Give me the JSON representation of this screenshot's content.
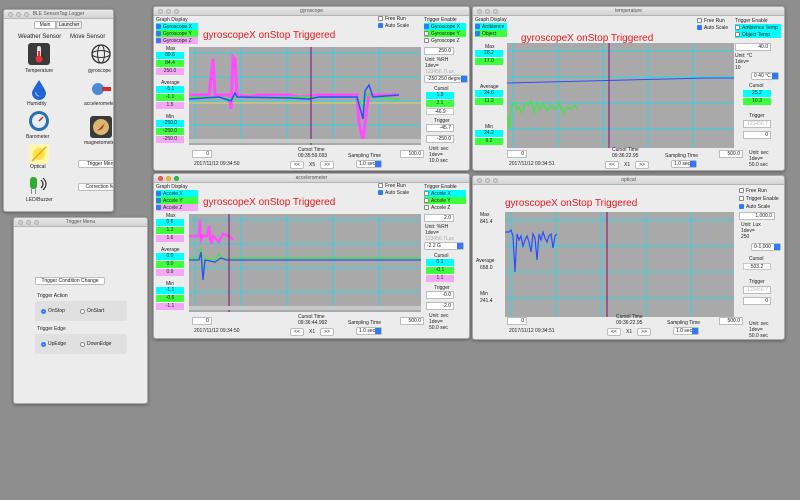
{
  "logger": {
    "title": "BLE SensorTag Logger",
    "tabs": [
      "Main",
      "Launcher"
    ],
    "weather_header": "Weather Sensor",
    "move_header": "Move Sensor",
    "items": {
      "temperature": "Temperature",
      "humidity": "Humidity",
      "barometer": "Barometer",
      "optical": "Optical",
      "gyroscope": "gyroscope",
      "accelerometer": "accelerometer",
      "magnetometer": "magnetometer",
      "led": "LED/Buzzer"
    },
    "trigger_menu_btn": "Trigger Menu",
    "correction_menu_btn": "Correction Menu"
  },
  "trigger_menu": {
    "title": "Trigger Menu",
    "change_btn": "Trigger Condition Change",
    "action_label": "Trigger Action",
    "action_on_stop": "OnStop",
    "action_on_start": "OnStart",
    "edge_label": "Trigger Edge",
    "edge_up": "UpEdge",
    "edge_down": "DownEdge"
  },
  "common": {
    "graph_display": "Graph Display",
    "trigger_enable": "Trigger Enable",
    "free_run": "Free Run",
    "auto_scale": "Auto Scale",
    "max": "Max",
    "average": "Average",
    "min": "Min",
    "cursol": "Cursol",
    "trigger": "Trigger",
    "cursol_time": "Cursol Time",
    "sampling_time": "Sampling Time",
    "triggered_msg": "gyroscopeX onStop Triggered",
    "prev_btn": "<<",
    "next_btn": ">>",
    "sampling_value": "1.0 sec",
    "start_date": "2017/11/12 09:34:50",
    "start_date_short": "2017/11/12 09:34:51",
    "zero": "0",
    "unit_sec": "Unit:  sec",
    "unit_sec2": "Unit:   sec"
  },
  "gyroscope": {
    "title": "gyroscope",
    "series": [
      "Gyroscope X",
      "Gyroscope Y",
      "Gyroscope Z"
    ],
    "max_vals": [
      "89.6",
      "84.4",
      "250.0"
    ],
    "avg_vals": [
      "-5.1",
      "-1.1",
      "1.5"
    ],
    "min_vals": [
      "-250.0",
      "-250.0",
      "-250.0"
    ],
    "scale_max": "250.0",
    "unit": "Unit:  %RH",
    "div": "1dev=",
    "div_hint": "123456.7Lux",
    "range": "-250 250 degree",
    "cursol_vals": [
      "1.9",
      "2.1",
      "-46.9"
    ],
    "trigger_val": "-45.7",
    "scale_min": "-250.0",
    "cursol_time": "09:35:59.693",
    "scroll_val": "100.0",
    "x_mult": "X5",
    "div_time": "1dev=",
    "div_time_val": "10.0 sec"
  },
  "accelerometer": {
    "title": "accelerometer",
    "series": [
      "Accele X",
      "Accele Y",
      "Accele Z"
    ],
    "max_vals": [
      "0.6",
      "1.2",
      "1.6"
    ],
    "avg_vals": [
      "0.0",
      "0.0",
      "0.9"
    ],
    "min_vals": [
      "-1.1",
      "-0.6",
      "-1.1"
    ],
    "scale_max": "2.0",
    "unit": "Unit:  %RH",
    "div": "1dev=",
    "div_hint": "123456.7Lux",
    "range": "-2 2 G",
    "cursol_vals": [
      "0.1",
      "-0.1",
      "1.1"
    ],
    "trigger_val": "-0.0",
    "scale_min": "-2.0",
    "cursol_time": "09:36:44.992",
    "scroll_val": "500.0",
    "x_mult": "X1",
    "div_time": "1dev=",
    "div_time_val": "50.0 sec"
  },
  "temperature": {
    "title": "temperature",
    "series": [
      "Ambience",
      "Object"
    ],
    "trigger_series": [
      "Ambience Temp",
      "Object Temp"
    ],
    "max_vals": [
      "28.2",
      "17.0"
    ],
    "avg_vals": [
      "24.6",
      "11.3"
    ],
    "min_vals": [
      "24.2",
      "9.2"
    ],
    "scale_max": "40.0",
    "unit": "Unit:  °C",
    "div": "1dev=",
    "div_val": "10",
    "range": "0 40 °C",
    "cursol_vals": [
      "25.2",
      "10.3"
    ],
    "trigger_hint": "123456.7",
    "scale_min": "0",
    "cursol_time": "09:36:22.95",
    "scroll_val": "500.0",
    "x_mult": "X1",
    "div_time": "1dev=",
    "div_time_val": "50.0 sec"
  },
  "optical": {
    "title": "optical",
    "max_val": "841.4",
    "avg_val": "658.0",
    "min_val": "241.4",
    "trigger_enable": "Trigger Enable",
    "scale_max": "1,000.0",
    "unit": "Unit:  Lux",
    "div": "1dev=",
    "div_val": "250",
    "range": "0-1,000",
    "cursol_val": "503.2",
    "trigger_hint": "123456.7",
    "scale_min": "0",
    "cursol_time": "09:36:22.95",
    "scroll_val": "500.0",
    "x_mult": "X1",
    "div_time": "1dev=",
    "div_time_val": "50.0 sec"
  }
}
